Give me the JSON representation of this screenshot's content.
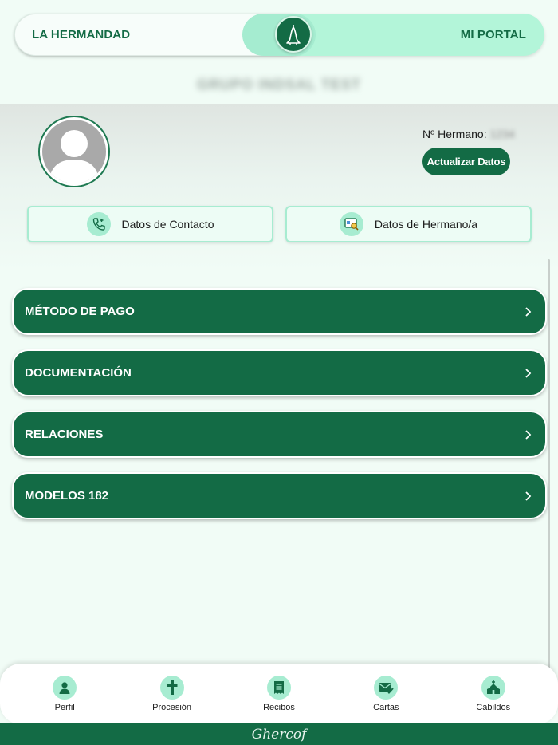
{
  "toggle": {
    "left_label": "LA HERMANDAD",
    "right_label": "MI PORTAL",
    "knob_icon": "nazareno-icon"
  },
  "profile": {
    "group_name": "GRUPO INDSAL TEST",
    "member_no_label": "Nº Hermano:",
    "member_no_value": "1234",
    "update_button": "Actualizar Datos",
    "avatar_icon": "user-avatar-icon"
  },
  "cards": [
    {
      "label": "Datos de Contacto",
      "icon": "phone-icon"
    },
    {
      "label": "Datos de Hermano/a",
      "icon": "id-card-search-icon"
    }
  ],
  "menu": [
    {
      "label": "MÉTODO DE PAGO"
    },
    {
      "label": "DOCUMENTACIÓN"
    },
    {
      "label": "RELACIONES"
    },
    {
      "label": "MODELOS 182"
    }
  ],
  "nav": [
    {
      "label": "Perfil",
      "icon": "person-icon"
    },
    {
      "label": "Procesión",
      "icon": "cross-icon"
    },
    {
      "label": "Recibos",
      "icon": "receipt-icon"
    },
    {
      "label": "Cartas",
      "icon": "mail-icon"
    },
    {
      "label": "Cabildos",
      "icon": "church-icon"
    }
  ],
  "footer": {
    "brand": "Ghercof"
  },
  "colors": {
    "primary": "#136b45",
    "accent": "#a7ecd1",
    "background": "#f1fcf6"
  }
}
